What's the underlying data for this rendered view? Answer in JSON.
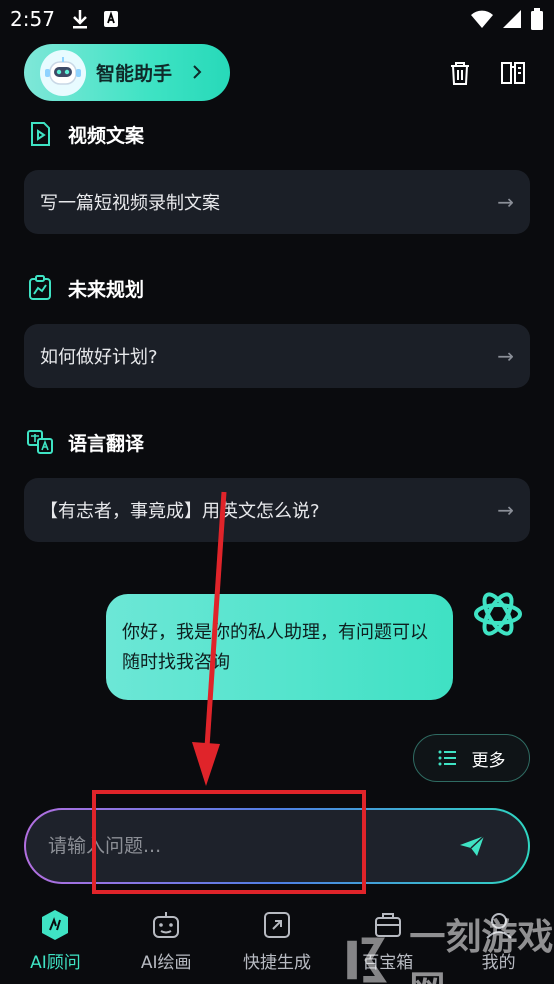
{
  "statusbar": {
    "time": "2:57"
  },
  "assistant": {
    "label": "智能助手"
  },
  "sections": [
    {
      "title": "视频文案",
      "suggestion": "写一篇短视频录制文案"
    },
    {
      "title": "未来规划",
      "suggestion": "如何做好计划?"
    },
    {
      "title": "语言翻译",
      "suggestion": "【有志者，事竟成】用英文怎么说?"
    }
  ],
  "chat": {
    "bot_message": "你好，我是你的私人助理，有问题可以随时找我咨询"
  },
  "more_button": {
    "label": "更多"
  },
  "input": {
    "placeholder": "请输入问题..."
  },
  "tabs": [
    {
      "label": "AI顾问",
      "active": true
    },
    {
      "label": "AI绘画",
      "active": false
    },
    {
      "label": "快捷生成",
      "active": false
    },
    {
      "label": "百宝箱",
      "active": false
    },
    {
      "label": "我的",
      "active": false
    }
  ],
  "watermark": {
    "text": "一刻游戏网"
  },
  "colors": {
    "accent": "#3fe3c4",
    "annotation_red": "#e0242a",
    "card_bg": "#1b1f27"
  }
}
